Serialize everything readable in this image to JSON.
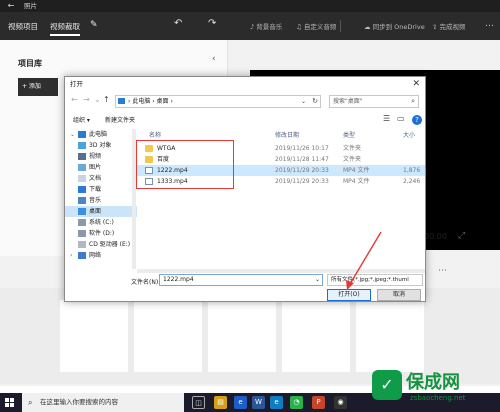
{
  "app": {
    "title": "照片",
    "tabs": [
      "视频项目",
      "视频裁取"
    ],
    "tools": [
      "背景音乐",
      "自定义音频",
      "同步到 OneDrive",
      "完成视频"
    ],
    "library": {
      "title": "项目库",
      "add_label": "+ 添加"
    },
    "timecode": "00.00"
  },
  "dialog": {
    "title": "打开",
    "path": [
      "此电脑",
      "桌面"
    ],
    "search_placeholder": "搜索\"桌面\"",
    "commands": {
      "organize": "组织 ▾",
      "new_folder": "新建文件夹"
    },
    "tree": [
      {
        "label": "此电脑",
        "icon": "computer-icon"
      },
      {
        "label": "3D 对象",
        "icon": "cube-icon"
      },
      {
        "label": "视频",
        "icon": "video-folder-icon"
      },
      {
        "label": "图片",
        "icon": "picture-folder-icon"
      },
      {
        "label": "文档",
        "icon": "document-folder-icon"
      },
      {
        "label": "下载",
        "icon": "download-folder-icon"
      },
      {
        "label": "音乐",
        "icon": "music-folder-icon"
      },
      {
        "label": "桌面",
        "icon": "desktop-folder-icon",
        "selected": true
      },
      {
        "label": "系统 (C:)",
        "icon": "drive-icon"
      },
      {
        "label": "软件 (D:)",
        "icon": "drive-icon"
      },
      {
        "label": "CD 驱动器 (E:)",
        "icon": "cd-drive-icon"
      },
      {
        "label": "网络",
        "icon": "network-icon"
      }
    ],
    "columns": {
      "name": "名称",
      "modified": "修改日期",
      "type": "类型",
      "size": "大小"
    },
    "files": [
      {
        "name": "WTGA",
        "modified": "2019/11/26 10:17",
        "type": "文件夹",
        "size": "",
        "icon": "folder-icon"
      },
      {
        "name": "百度",
        "modified": "2019/11/28 11:47",
        "type": "文件夹",
        "size": "",
        "icon": "folder-icon"
      },
      {
        "name": "1222.mp4",
        "modified": "2019/11/29 20:33",
        "type": "MP4 文件",
        "size": "1,876",
        "icon": "video-file-icon",
        "selected": true
      },
      {
        "name": "1333.mp4",
        "modified": "2019/11/29 20:33",
        "type": "MP4 文件",
        "size": "2,246",
        "icon": "video-file-icon"
      }
    ],
    "filename_label": "文件名(N):",
    "filename_value": "1222.mp4",
    "filter": "所有文件(*.jpg;*.jpeg;*.thuml",
    "open_label": "打开(O)",
    "cancel_label": "取消"
  },
  "taskbar": {
    "search_placeholder": "在这里输入你要搜索的内容"
  },
  "watermark": {
    "name": "保成网",
    "url": "zsbaocheng.net"
  },
  "colors": {
    "accent": "#1a6fd6",
    "highlight_box": "#e53935",
    "selection": "#cce8ff"
  }
}
